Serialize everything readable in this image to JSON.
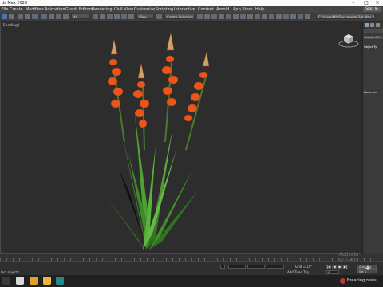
{
  "window": {
    "title": "ds Max 2020"
  },
  "menu": {
    "items": [
      "File",
      "Create",
      "Modifiers",
      "Animation",
      "Graph Editors",
      "Rendering",
      "Civil View",
      "Customize",
      "Scripting",
      "Interactive",
      "Content",
      "Arnold",
      "App Store",
      "Help"
    ],
    "sign_in": "Sign In",
    "path": "C:\\Users\\Mit\\Documents\\3ds Max 2020"
  },
  "toolbar": {
    "filter_dropdown": "All",
    "view_dropdown": "View",
    "selection_set": "Create Selection Se"
  },
  "viewport": {
    "label": "[Shading]"
  },
  "command_panel": {
    "dropdown": "Standard Pri",
    "object_type": "Object Ty",
    "name_and_color": "Name an"
  },
  "status": {
    "selection": "lect objects",
    "add_time_tag": "Add Time Tag",
    "grid": "Grid = 10\"",
    "frame": "0",
    "auto_key": "Auto Key",
    "set_key": "Set K"
  },
  "watermark": {
    "line1": "Activate",
    "line2": "Go to Setti"
  },
  "taskbar": {
    "news": "Breaking news"
  },
  "colors": {
    "accent": "#5d87c2",
    "petal": "#e8561b",
    "leaf": "#3f8f2a"
  }
}
